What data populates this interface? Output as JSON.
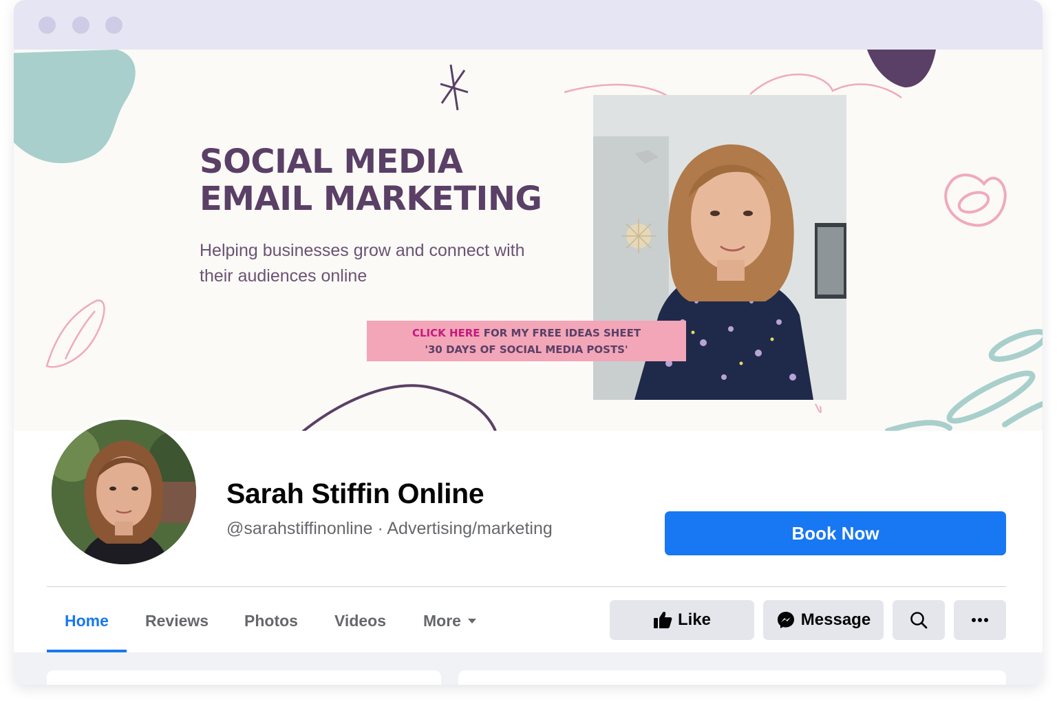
{
  "cover": {
    "headline_line1": "SOCIAL MEDIA",
    "headline_line2": "EMAIL MARKETING",
    "subtitle": "Helping businesses grow and connect with their audiences online",
    "cta_highlight": "CLICK HERE",
    "cta_line1_rest": " FOR MY FREE IDEAS SHEET",
    "cta_line2": "'30 DAYS OF SOCIAL MEDIA POSTS'"
  },
  "profile": {
    "name": "Sarah Stiffin Online",
    "meta": "@sarahstiffinonline · Advertising/marketing",
    "book_label": "Book Now"
  },
  "tabs": [
    {
      "label": "Home",
      "active": true
    },
    {
      "label": "Reviews"
    },
    {
      "label": "Photos"
    },
    {
      "label": "Videos"
    },
    {
      "label": "More"
    }
  ],
  "actions": {
    "like": "Like",
    "message": "Message"
  },
  "icons": [
    "like-icon",
    "messenger-icon",
    "search-icon",
    "more-dots-icon",
    "chevron-down-icon"
  ],
  "colors": {
    "brand_blue": "#1877f2",
    "cover_purple": "#5a3f66",
    "cta_pink": "#f2a6b8",
    "accent_teal": "#a8cfcc"
  }
}
